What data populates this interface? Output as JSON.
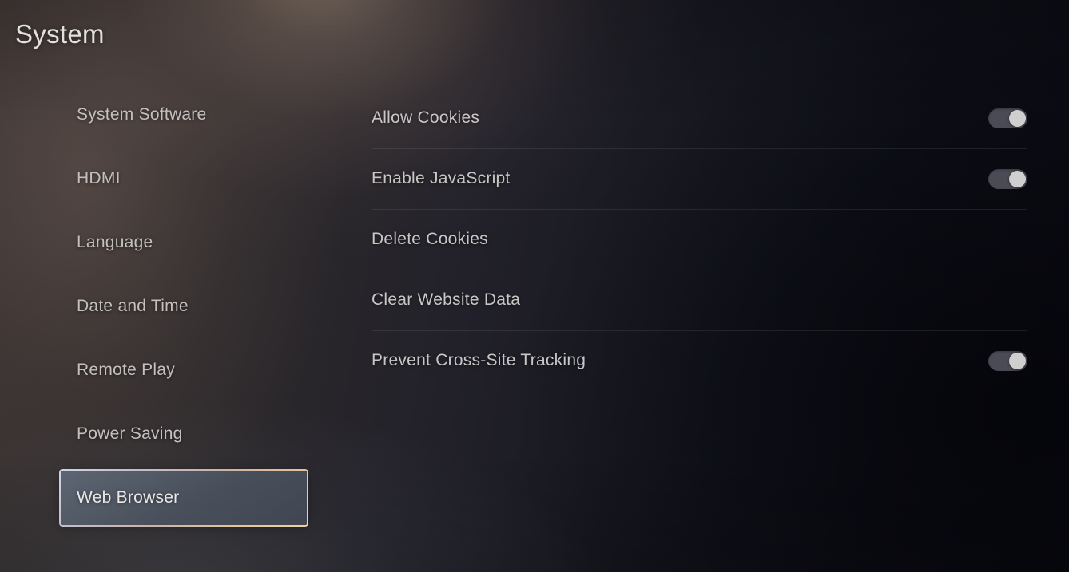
{
  "header": {
    "title": "System"
  },
  "sidebar": {
    "items": [
      {
        "label": "System Software",
        "selected": false
      },
      {
        "label": "HDMI",
        "selected": false
      },
      {
        "label": "Language",
        "selected": false
      },
      {
        "label": "Date and Time",
        "selected": false
      },
      {
        "label": "Remote Play",
        "selected": false
      },
      {
        "label": "Power Saving",
        "selected": false
      },
      {
        "label": "Web Browser",
        "selected": true
      }
    ]
  },
  "settings": {
    "rows": [
      {
        "label": "Allow Cookies",
        "control": "toggle",
        "value": "on"
      },
      {
        "label": "Enable JavaScript",
        "control": "toggle",
        "value": "on"
      },
      {
        "label": "Delete Cookies",
        "control": "none",
        "value": ""
      },
      {
        "label": "Clear Website Data",
        "control": "none",
        "value": ""
      },
      {
        "label": "Prevent Cross-Site Tracking",
        "control": "toggle",
        "value": "on"
      }
    ]
  },
  "theme": {
    "text_primary": "#c9c7c6",
    "text_title": "#e3e1e0",
    "selection_fill": "#4a5260",
    "selection_border_start": "#cfd5e4",
    "selection_border_end": "#edd2a6",
    "toggle_track_on": "#4b4b55",
    "toggle_knob": "#cfcfcf",
    "divider": "rgba(255,255,255,0.085)",
    "background_warm": "#cbb29c",
    "background_dark": "#0a0b12"
  }
}
